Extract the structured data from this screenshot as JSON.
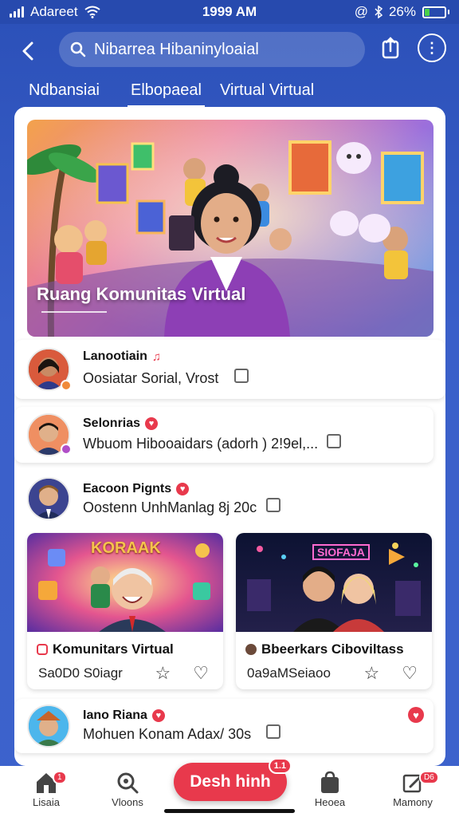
{
  "status_bar": {
    "carrier": "Adareet",
    "time": "1999 AM",
    "battery_percent": "26%",
    "battery_level": 0.26,
    "colors": {
      "battery": "#4ad14a"
    }
  },
  "header": {
    "search_text": "Nibarrea Hibaninyloaial"
  },
  "tabs": [
    {
      "label": "Ndbansiai"
    },
    {
      "label": "Elbopaeal"
    },
    {
      "label": "Virtual  Virtual"
    }
  ],
  "hero": {
    "title": "Ruang Komunitas Virtual"
  },
  "list_items": [
    {
      "name": "Lanootiain",
      "subtitle": "Oosiatar Sorial, Vrost"
    },
    {
      "name": "Selonrias",
      "subtitle": "Wbuom Hibooaidars (adorh ) 2!9el,..."
    },
    {
      "name": "Eacoon Pignts",
      "subtitle": "Oostenn UnhManlag 8j 20c"
    }
  ],
  "cards": [
    {
      "banner": "KORAAK",
      "title": "Komunitars Virtual",
      "subtitle": "Sa0D0 S0iagr"
    },
    {
      "banner": "SIOFAJA",
      "title": "Bbeerkars Ciboviltass",
      "subtitle": "0a9aMSeiaoo"
    }
  ],
  "last_item": {
    "name": "Iano Riana",
    "subtitle": "Mohuen Konam Adax/ 30s"
  },
  "bottom_nav": {
    "items": [
      {
        "label": "Lisaia",
        "icon": "home-icon",
        "badge": "1"
      },
      {
        "label": "Vloons",
        "icon": "search-icon"
      },
      {
        "label": "Heoea",
        "icon": "bag-icon"
      },
      {
        "label": "Mamony",
        "icon": "edit-icon",
        "badge": "D6"
      }
    ],
    "cta_label": "Desh hinh",
    "cta_badge": "1.1"
  },
  "colors": {
    "primary": "#2b50b8",
    "accent": "#e8394c"
  }
}
